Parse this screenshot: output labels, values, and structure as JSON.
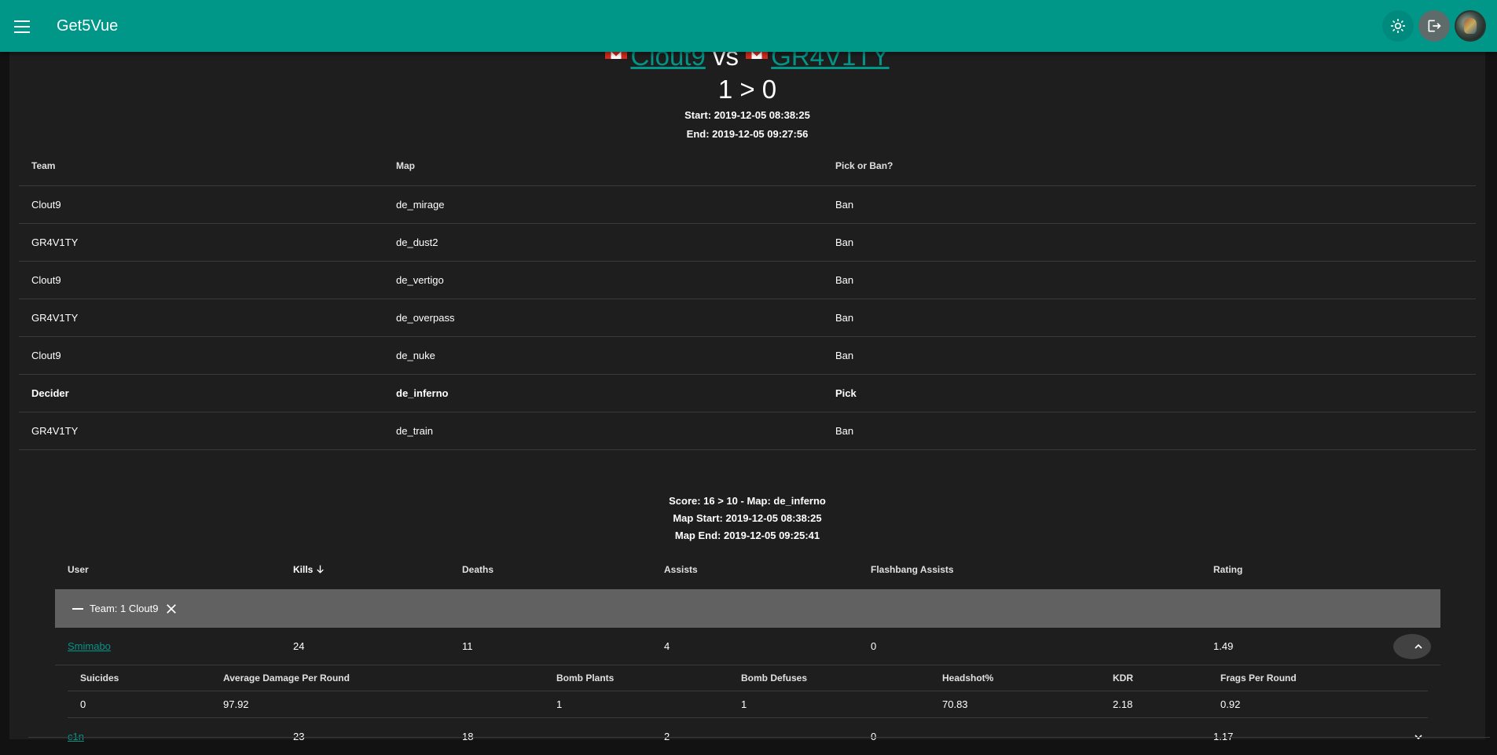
{
  "app": {
    "title": "Get5Vue"
  },
  "match": {
    "team1": "Clout9",
    "vs": "vs",
    "team2": "GR4V1TY",
    "series_score": "1 > 0",
    "start": "Start: 2019-12-05 08:38:25",
    "end": "End: 2019-12-05 09:27:56"
  },
  "veto": {
    "headers": [
      "Team",
      "Map",
      "Pick or Ban?"
    ],
    "rows": [
      {
        "team": "Clout9",
        "map": "de_mirage",
        "action": "Ban"
      },
      {
        "team": "GR4V1TY",
        "map": "de_dust2",
        "action": "Ban"
      },
      {
        "team": "Clout9",
        "map": "de_vertigo",
        "action": "Ban"
      },
      {
        "team": "GR4V1TY",
        "map": "de_overpass",
        "action": "Ban"
      },
      {
        "team": "Clout9",
        "map": "de_nuke",
        "action": "Ban"
      },
      {
        "team": "Decider",
        "map": "de_inferno",
        "action": "Pick"
      },
      {
        "team": "GR4V1TY",
        "map": "de_train",
        "action": "Ban"
      }
    ]
  },
  "map_stats": {
    "score": "Score: 16 > 10 - Map: de_inferno",
    "map_start": "Map Start: 2019-12-05 08:38:25",
    "map_end": "Map End: 2019-12-05 09:25:41",
    "headers": [
      "User",
      "Kills",
      "Deaths",
      "Assists",
      "Flashbang Assists",
      "Rating"
    ],
    "group_label": "Team: 1 Clout9",
    "players": [
      {
        "user": "Smimabo",
        "kills": "24",
        "deaths": "11",
        "assists": "4",
        "flash_assists": "0",
        "rating": "1.49"
      },
      {
        "user": "c1n",
        "kills": "23",
        "deaths": "18",
        "assists": "2",
        "flash_assists": "0",
        "rating": "1.17"
      }
    ],
    "detail_headers": [
      "Suicides",
      "Average Damage Per Round",
      "Bomb Plants",
      "Bomb Defuses",
      "Headshot%",
      "KDR",
      "Frags Per Round"
    ],
    "detail_values": [
      "0",
      "97.92",
      "1",
      "1",
      "70.83",
      "2.18",
      "0.92"
    ]
  },
  "icons": {
    "menu": "menu-icon",
    "theme": "brightness-icon",
    "logout": "logout-icon",
    "sort": "arrow-down-icon",
    "close": "close-icon",
    "expand": "chevron-up-icon",
    "collapse": "chevron-down-icon"
  },
  "colors": {
    "primary": "#009688",
    "background": "#121212",
    "surface": "#1e1e1e",
    "group_row": "#616161"
  }
}
